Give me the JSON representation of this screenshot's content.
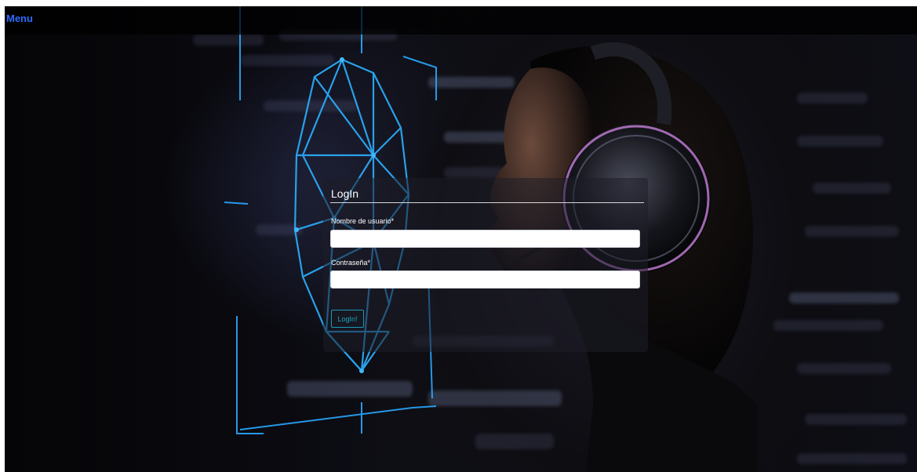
{
  "nav": {
    "menu_label": "Menu"
  },
  "login": {
    "title": "LogIn",
    "username_label": "Nombre de usuario*",
    "username_value": "",
    "password_label": "Contraseña*",
    "password_value": "",
    "submit_label": "LogIn!"
  },
  "colors": {
    "menu_link": "#2e6bff",
    "button_accent": "#1ba8c2",
    "scan_lines": "#2aa8ff"
  },
  "background": {
    "description_icon": "face-scan-graphic"
  }
}
